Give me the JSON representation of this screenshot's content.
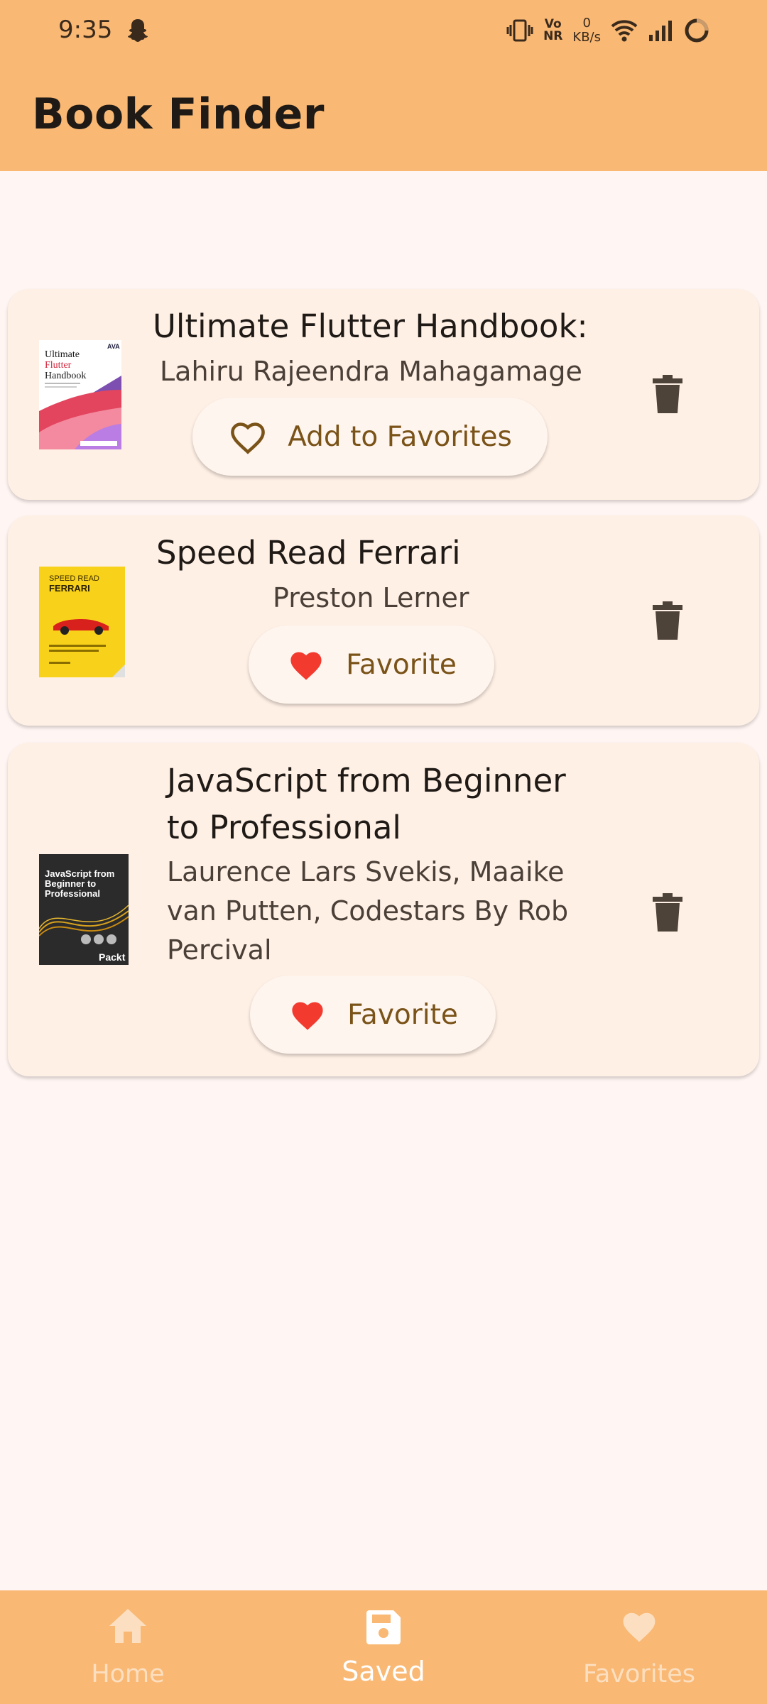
{
  "status_bar": {
    "time": "9:35",
    "volte_top": "Vo",
    "volte_bottom": "NR",
    "net_speed_value": "0",
    "net_speed_unit": "KB/s",
    "icons": [
      "snapchat-icon",
      "vibrate-icon",
      "volte-icon",
      "wifi-icon",
      "signal-icon",
      "loading-ring-icon"
    ]
  },
  "app_bar": {
    "title": "Book Finder"
  },
  "books": [
    {
      "title": "Ultimate Flutter Handbook:",
      "author": "Lahiru Rajeendra Mahagamage",
      "favorite_label": "Add to Favorites",
      "is_favorite": false,
      "cover": {
        "publisher": "AVA",
        "title_line1": "Ultimate",
        "title_line2": "Flutter",
        "title_line3": "Handbook"
      }
    },
    {
      "title": "Speed Read Ferrari",
      "author": "Preston Lerner",
      "favorite_label": "Favorite",
      "is_favorite": true,
      "cover": {
        "title_line1": "SPEED READ",
        "title_line2": "FERRARI"
      }
    },
    {
      "title_line1": "JavaScript from Beginner",
      "title_line2": "to Professional",
      "author_line1": "Laurence Lars Svekis, Maaike",
      "author_line2": "van Putten, Codestars By Rob",
      "author_line3": "Percival",
      "favorite_label": "Favorite",
      "is_favorite": true,
      "cover": {
        "title_line1": "JavaScript from",
        "title_line2": "Beginner to",
        "title_line3": "Professional",
        "publisher": "Packt"
      }
    }
  ],
  "bottom_nav": {
    "items": [
      {
        "label": "Home",
        "icon": "home-icon",
        "selected": false
      },
      {
        "label": "Saved",
        "icon": "save-icon",
        "selected": true
      },
      {
        "label": "Favorites",
        "icon": "heart-icon",
        "selected": false
      }
    ]
  },
  "colors": {
    "app_bar": "#f9b873",
    "background": "#fff5f2",
    "card": "#fff0e5",
    "heart_filled": "#f23a2f",
    "button_text": "#7a5318",
    "trash": "#4e4339"
  }
}
